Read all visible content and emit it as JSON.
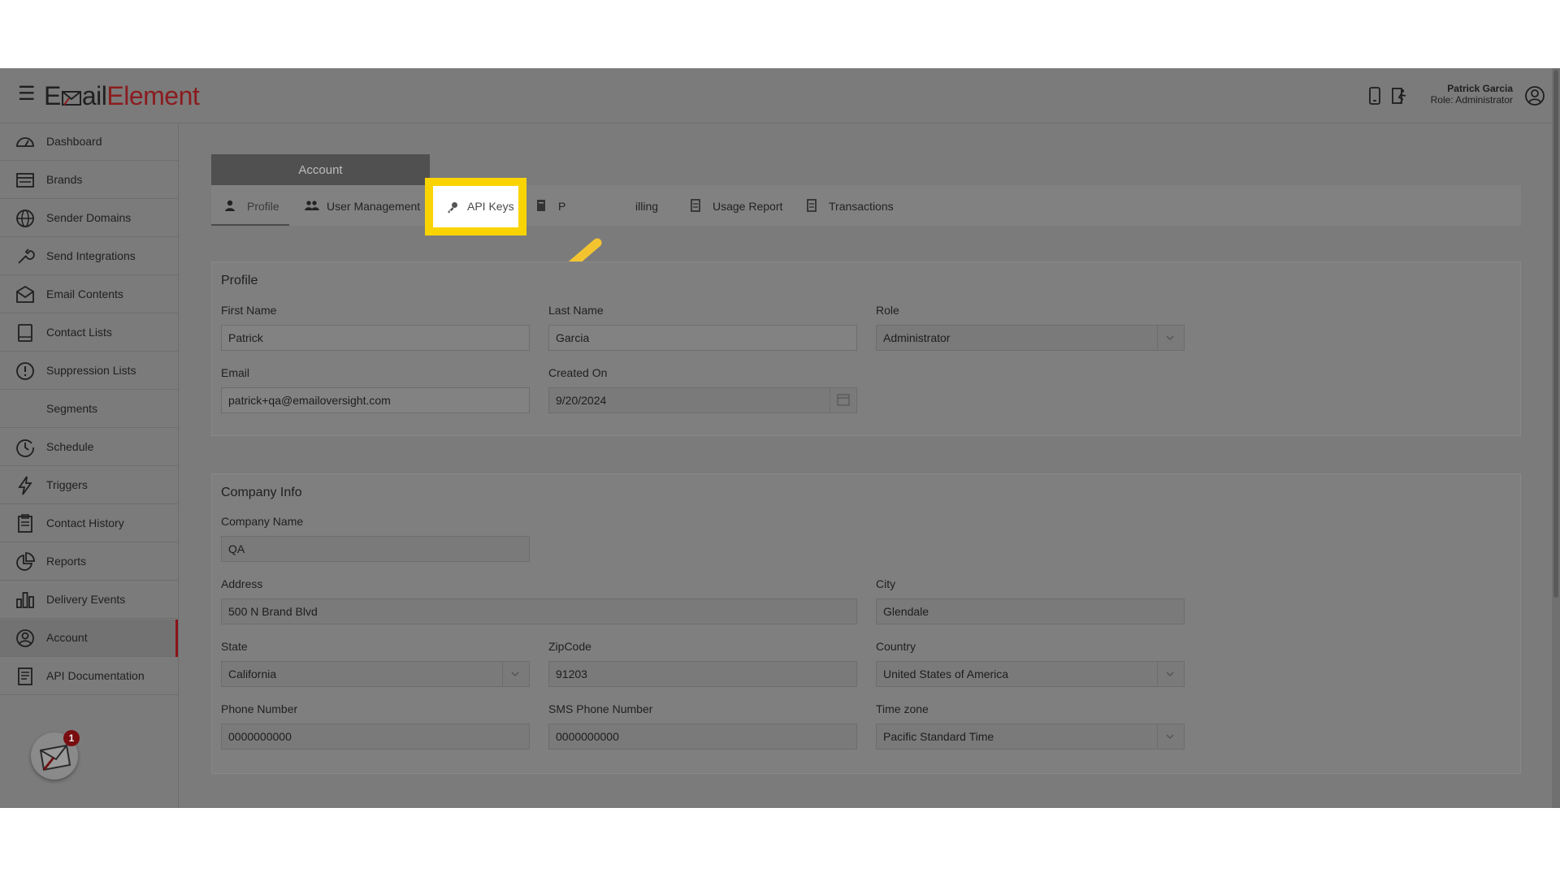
{
  "header": {
    "logo_part1": "E",
    "logo_part2": "ail",
    "logo_part3": "Element",
    "user_name": "Patrick Garcia",
    "user_role": "Role: Administrator"
  },
  "sidebar": {
    "items": [
      {
        "label": "Dashboard",
        "icon": "dashboard-gauge-icon"
      },
      {
        "label": "Brands",
        "icon": "brands-card-icon"
      },
      {
        "label": "Sender Domains",
        "icon": "globe-icon"
      },
      {
        "label": "Send Integrations",
        "icon": "wrench-icon"
      },
      {
        "label": "Email Contents",
        "icon": "envelope-icon"
      },
      {
        "label": "Contact Lists",
        "icon": "book-icon"
      },
      {
        "label": "Suppression Lists",
        "icon": "alert-circle-icon"
      },
      {
        "label": "Segments",
        "icon": ""
      },
      {
        "label": "Schedule",
        "icon": "clock-icon"
      },
      {
        "label": "Triggers",
        "icon": "lightning-icon"
      },
      {
        "label": "Contact History",
        "icon": "clipboard-icon"
      },
      {
        "label": "Reports",
        "icon": "pie-chart-icon"
      },
      {
        "label": "Delivery Events",
        "icon": "bar-chart-icon"
      },
      {
        "label": "Account",
        "icon": "user-circle-icon"
      },
      {
        "label": "API Documentation",
        "icon": "document-icon"
      }
    ],
    "active": "Account",
    "chat_badge": "1"
  },
  "account": {
    "header": "Account",
    "tabs": {
      "profile": "Profile",
      "user_management": "User Management",
      "api_keys": "API Keys",
      "plans_partial": "P",
      "billing_partial": "illing",
      "usage_report": "Usage Report",
      "transactions": "Transactions"
    }
  },
  "profile": {
    "title": "Profile",
    "first_name_label": "First Name",
    "first_name": "Patrick",
    "last_name_label": "Last Name",
    "last_name": "Garcia",
    "role_label": "Role",
    "role": "Administrator",
    "email_label": "Email",
    "email": "patrick+qa@emailoversight.com",
    "created_label": "Created On",
    "created": "9/20/2024"
  },
  "company": {
    "title": "Company Info",
    "name_label": "Company Name",
    "name": "QA",
    "address_label": "Address",
    "address": "500 N Brand Blvd",
    "city_label": "City",
    "city": "Glendale",
    "state_label": "State",
    "state": "California",
    "zip_label": "ZipCode",
    "zip": "91203",
    "country_label": "Country",
    "country": "United States of America",
    "phone_label": "Phone Number",
    "phone": "0000000000",
    "sms_label": "SMS Phone Number",
    "sms": "0000000000",
    "tz_label": "Time zone",
    "tz": "Pacific Standard Time"
  },
  "colors": {
    "highlight": "#fad400",
    "arrow": "#f4c430",
    "brand_red": "#8b1c1f",
    "overlay_gray": "#7b7b7b"
  }
}
